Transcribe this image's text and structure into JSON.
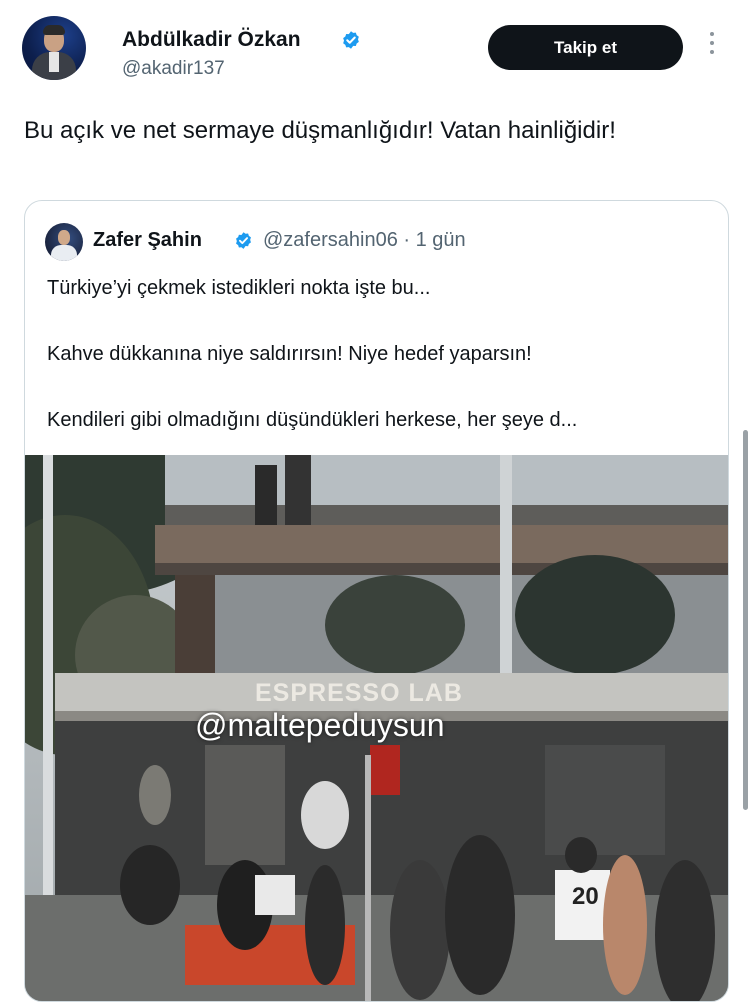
{
  "author": {
    "display_name": "Abdülkadir Özkan",
    "handle": "@akadir137",
    "verified": true,
    "follow_label": "Takip et"
  },
  "tweet": {
    "text": "Bu açık ve net sermaye düşmanlığıdır! Vatan hainliğidir!"
  },
  "quoted": {
    "display_name": "Zafer Şahin",
    "handle_time": "@zafersahin06 · 1 gün",
    "lines": [
      "Türkiye’yi çekmek istedikleri nokta işte bu...",
      "Kahve dükkanına niye saldırırsın! Niye hedef yaparsın!",
      "Kendileri gibi olmadığını düşündükleri herkese, her şeye d..."
    ],
    "media": {
      "sign_text": "ESPRESSO LAB",
      "watermark": "@maltepeduysun",
      "jersey_number": "20"
    }
  },
  "colors": {
    "primary_text": "#0f1419",
    "secondary_text": "#536471",
    "verified_blue": "#1d9bf0",
    "border": "#cfd9de"
  },
  "icons": [
    "verified-badge-icon",
    "more-options-icon"
  ]
}
